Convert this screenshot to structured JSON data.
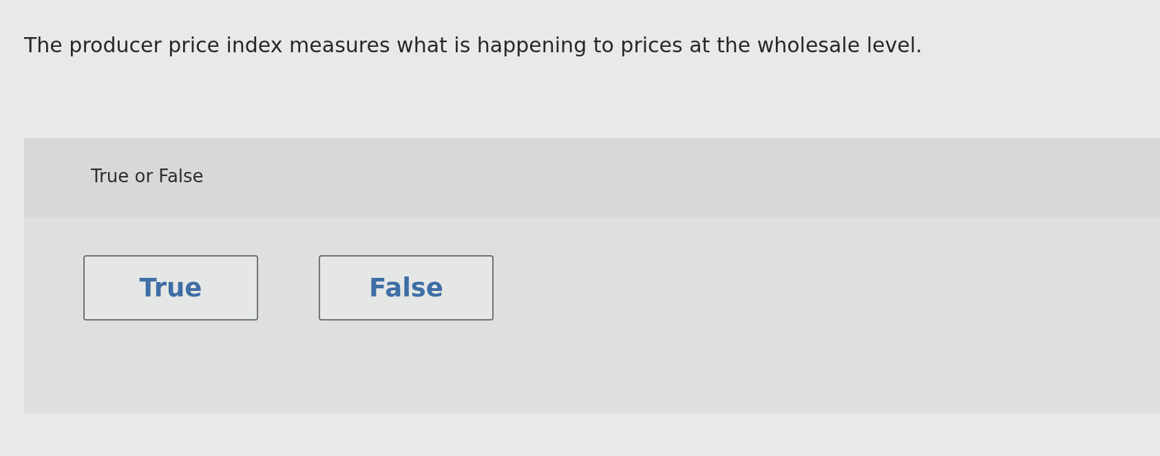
{
  "question": "The producer price index measures what is happening to prices at the wholesale level.",
  "prompt": "True or False",
  "options": [
    {
      "label": "True",
      "selected": false
    },
    {
      "label": "False",
      "selected": false
    }
  ]
}
